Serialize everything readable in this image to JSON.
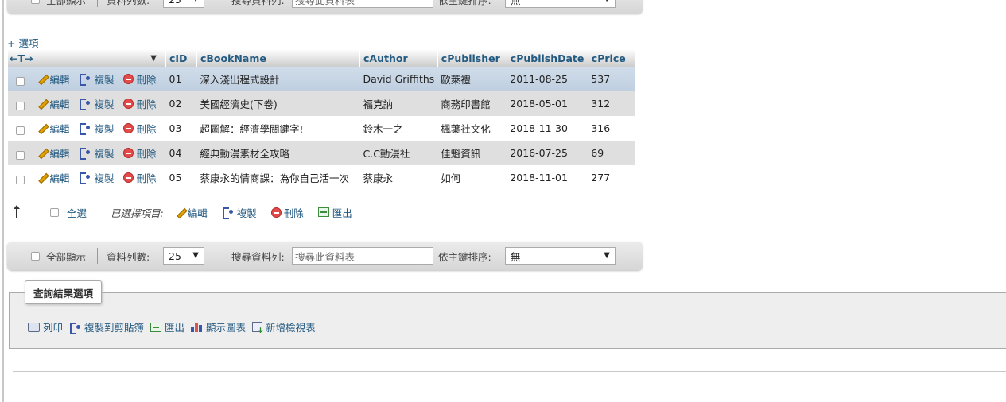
{
  "nav": {
    "show_all": "全部顯示",
    "rows_label": "資料列數:",
    "rows_value": "25",
    "search_label": "搜尋資料列:",
    "search_placeholder": "搜尋此資料表",
    "sort_label": "依主鍵排序:",
    "sort_value": "無"
  },
  "options_link": "+ 選項",
  "column_arrows": "←T→",
  "columns": [
    "cID",
    "cBookName",
    "cAuthor",
    "cPublisher",
    "cPublishDate",
    "cPrice"
  ],
  "row_actions": {
    "edit": "編輯",
    "copy": "複製",
    "delete": "刪除"
  },
  "rows": [
    {
      "cID": "01",
      "cBookName": "深入淺出程式設計",
      "cAuthor": "David Griffiths",
      "cPublisher": "歐萊禮",
      "cPublishDate": "2011-08-25",
      "cPrice": "537"
    },
    {
      "cID": "02",
      "cBookName": "美國經濟史(下卷)",
      "cAuthor": "福克訥",
      "cPublisher": "商務印書館",
      "cPublishDate": "2018-05-01",
      "cPrice": "312"
    },
    {
      "cID": "03",
      "cBookName": "超圖解：經濟學關鍵字!",
      "cAuthor": "鈴木一之",
      "cPublisher": "楓葉社文化",
      "cPublishDate": "2018-11-30",
      "cPrice": "316"
    },
    {
      "cID": "04",
      "cBookName": "經典動漫素材全攻略",
      "cAuthor": "C.C動漫社",
      "cPublisher": "佳魁資訊",
      "cPublishDate": "2016-07-25",
      "cPrice": "69"
    },
    {
      "cID": "05",
      "cBookName": "蔡康永的情商課：為你自己活一次",
      "cAuthor": "蔡康永",
      "cPublisher": "如何",
      "cPublishDate": "2018-11-01",
      "cPrice": "277"
    }
  ],
  "with_selected": {
    "check_all": "全選",
    "label": "已選擇項目:",
    "edit": "編輯",
    "copy": "複製",
    "delete": "刪除",
    "export": "匯出"
  },
  "query_ops": {
    "legend": "查詢結果選項",
    "print": "列印",
    "copy_clipboard": "複製到剪貼簿",
    "export": "匯出",
    "chart": "顯示圖表",
    "create_view": "新增檢視表"
  }
}
